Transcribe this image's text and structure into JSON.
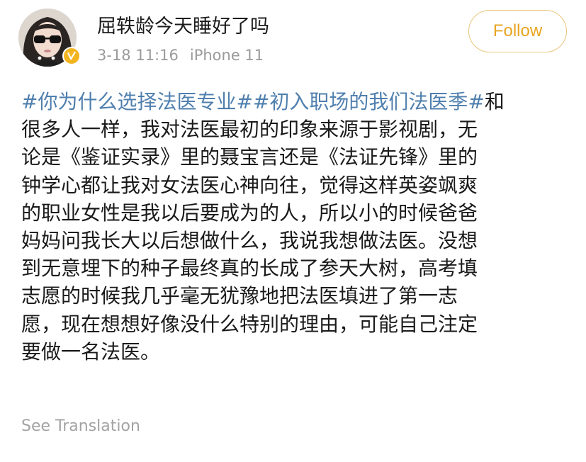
{
  "author": {
    "name": "屈轶龄今天睡好了吗",
    "avatar_icon": "user-avatar",
    "badge_icon": "verified-badge-icon"
  },
  "meta": {
    "date": "3-18 11:16",
    "device": "iPhone 11"
  },
  "follow_label": "Follow",
  "post": {
    "lines": [
      {
        "segments": [
          {
            "text": "#你为什么选择法医专业#",
            "type": "hashtag"
          },
          {
            "text": "#初入职场的我们法医季#",
            "type": "hashtag"
          },
          {
            "text": "和",
            "type": "text"
          }
        ]
      },
      {
        "segments": [
          {
            "text": "很多人一样，我对法医最初的印象来源于影视剧，无",
            "type": "text"
          }
        ]
      },
      {
        "segments": [
          {
            "text": "论是《鉴证实录》里的聂宝言还是《法证先锋》里的",
            "type": "text"
          }
        ]
      },
      {
        "segments": [
          {
            "text": "钟学心都让我对女法医心神向往，觉得这样英姿飒爽",
            "type": "text"
          }
        ]
      },
      {
        "segments": [
          {
            "text": "的职业女性是我以后要成为的人，所以小的时候爸爸",
            "type": "text"
          }
        ]
      },
      {
        "segments": [
          {
            "text": "妈妈问我长大以后想做什么，我说我想做法医。没想",
            "type": "text"
          }
        ]
      },
      {
        "segments": [
          {
            "text": "到无意埋下的种子最终真的长成了参天大树，高考填",
            "type": "text"
          }
        ]
      },
      {
        "segments": [
          {
            "text": "志愿的时候我几乎毫无犹豫地把法医填进了第一志",
            "type": "text"
          }
        ]
      },
      {
        "segments": [
          {
            "text": "愿，现在想想好像没什么特别的理由，可能自己注定",
            "type": "text"
          }
        ]
      },
      {
        "segments": [
          {
            "text": "要做一名法医。",
            "type": "text"
          }
        ]
      }
    ]
  },
  "see_translation": "See Translation",
  "colors": {
    "hashtag": "#4f7fae",
    "follow": "#e7a521",
    "follow_border": "#e9c57a",
    "meta": "#9a9a9a",
    "badge": "#f3b51f"
  }
}
